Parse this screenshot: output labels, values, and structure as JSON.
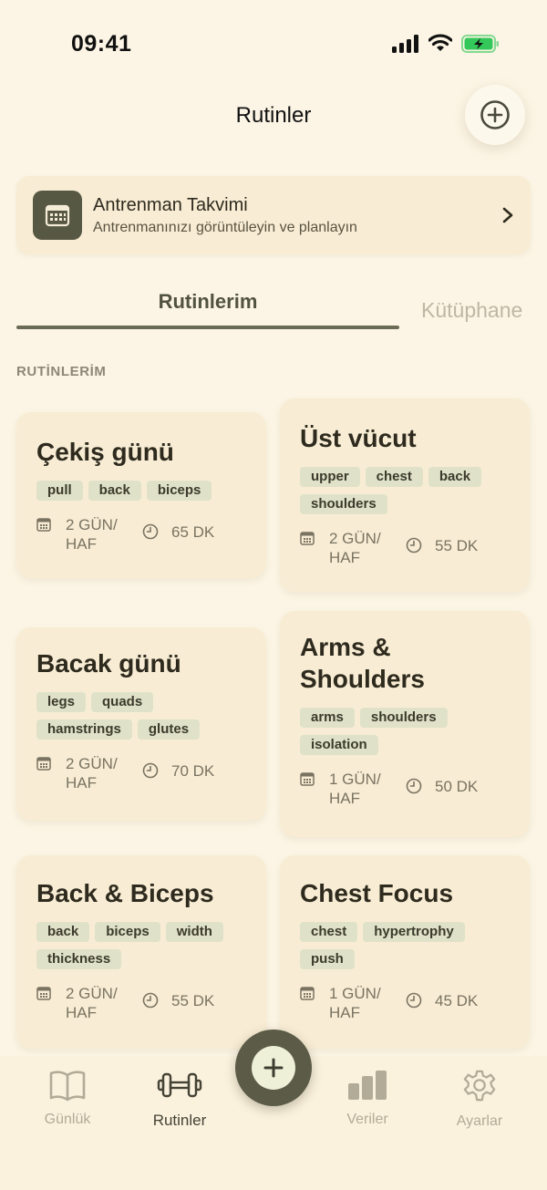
{
  "status_bar": {
    "time": "09:41"
  },
  "header": {
    "title": "Rutinler"
  },
  "calendar_banner": {
    "title": "Antrenman Takvimi",
    "subtitle": "Antrenmanınızı görüntüleyin ve planlayın"
  },
  "tabs": {
    "mine": "Rutinlerim",
    "library": "Kütüphane"
  },
  "section_label": "RUTİNLERİM",
  "routines": [
    {
      "title": "Çekiş günü",
      "tags": [
        "pull",
        "back",
        "biceps"
      ],
      "frequency": "2 GÜN/ HAF",
      "duration": "65 DK"
    },
    {
      "title": "Üst vücut",
      "tags": [
        "upper",
        "chest",
        "back",
        "shoulders"
      ],
      "frequency": "2 GÜN/ HAF",
      "duration": "55 DK"
    },
    {
      "title": "Bacak günü",
      "tags": [
        "legs",
        "quads",
        "hamstrings",
        "glutes"
      ],
      "frequency": "2 GÜN/ HAF",
      "duration": "70 DK"
    },
    {
      "title": "Arms & Shoulders",
      "tags": [
        "arms",
        "shoulders",
        "isolation"
      ],
      "frequency": "1 GÜN/ HAF",
      "duration": "50 DK"
    },
    {
      "title": "Back & Biceps",
      "tags": [
        "back",
        "biceps",
        "width",
        "thickness"
      ],
      "frequency": "2 GÜN/ HAF",
      "duration": "55 DK"
    },
    {
      "title": "Chest Focus",
      "tags": [
        "chest",
        "hypertrophy",
        "push"
      ],
      "frequency": "1 GÜN/ HAF",
      "duration": "45 DK"
    }
  ],
  "bottom_nav": {
    "items": [
      {
        "label": "Günlük",
        "icon": "book-icon",
        "active": false
      },
      {
        "label": "Rutinler",
        "icon": "dumbbell-icon",
        "active": true
      },
      {
        "label": "Veriler",
        "icon": "bar-chart-icon",
        "active": false
      },
      {
        "label": "Ayarlar",
        "icon": "gear-icon",
        "active": false
      }
    ]
  },
  "colors": {
    "background": "#fcf5e5",
    "card": "#f8edd4",
    "accent": "#5b5b47",
    "tag": "#dfe2c8"
  }
}
